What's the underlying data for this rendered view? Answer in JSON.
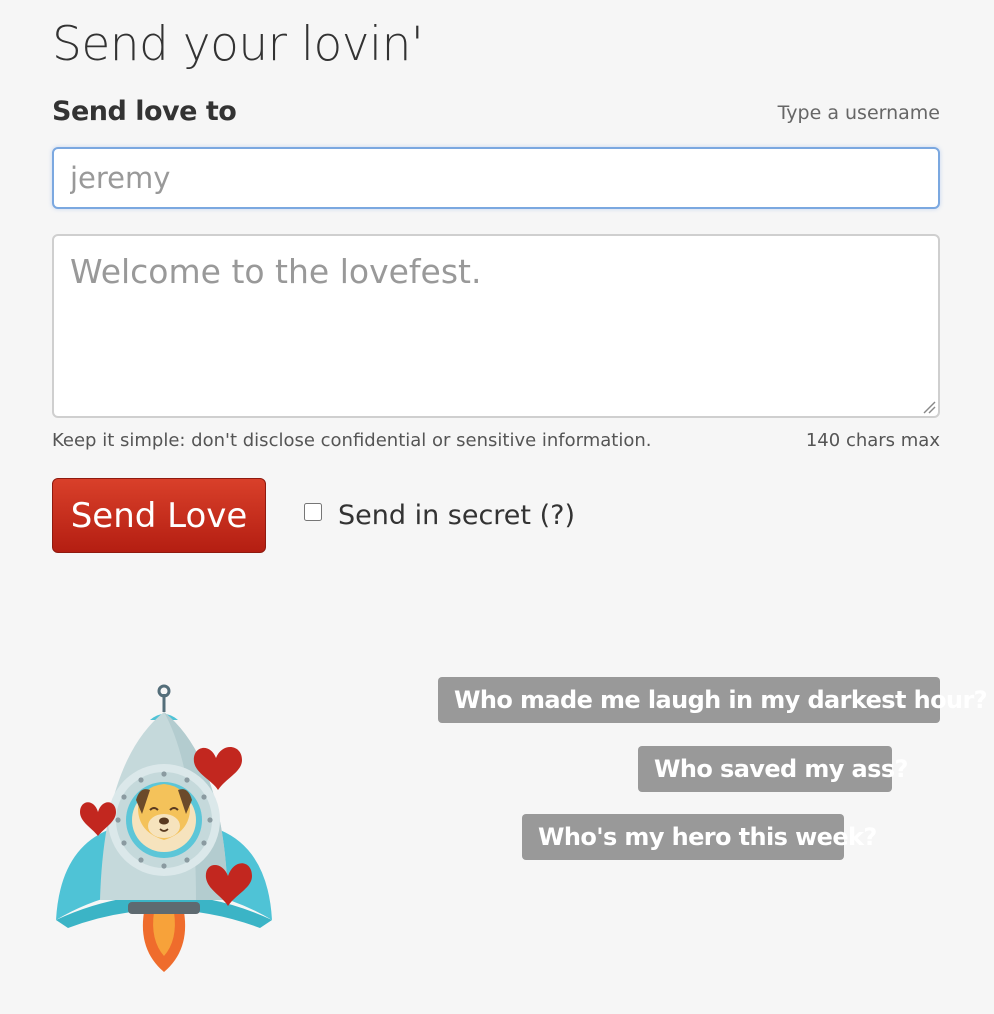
{
  "page": {
    "title": "Send your lovin'"
  },
  "form": {
    "recipient_label": "Send love to",
    "recipient_hint": "Type a username",
    "recipient_placeholder": "jeremy",
    "recipient_value": "",
    "message_placeholder": "Welcome to the lovefest.",
    "message_value": "",
    "help_text": "Keep it simple: don't disclose confidential or sensitive information.",
    "char_limit": "140 chars max",
    "submit_label": "Send Love",
    "secret_label": "Send in secret (?)",
    "secret_checked": false
  },
  "prompts": [
    "Who made me laugh in my darkest hour?",
    "Who saved my ass?",
    "Who's my hero this week?"
  ],
  "illustration": {
    "icon": "rocket-with-hearts-illustration"
  },
  "colors": {
    "submit_button": "#c62d1c",
    "focus_border": "#7ba8e0",
    "prompt_badge": "#999999",
    "heart": "#c2271f"
  }
}
